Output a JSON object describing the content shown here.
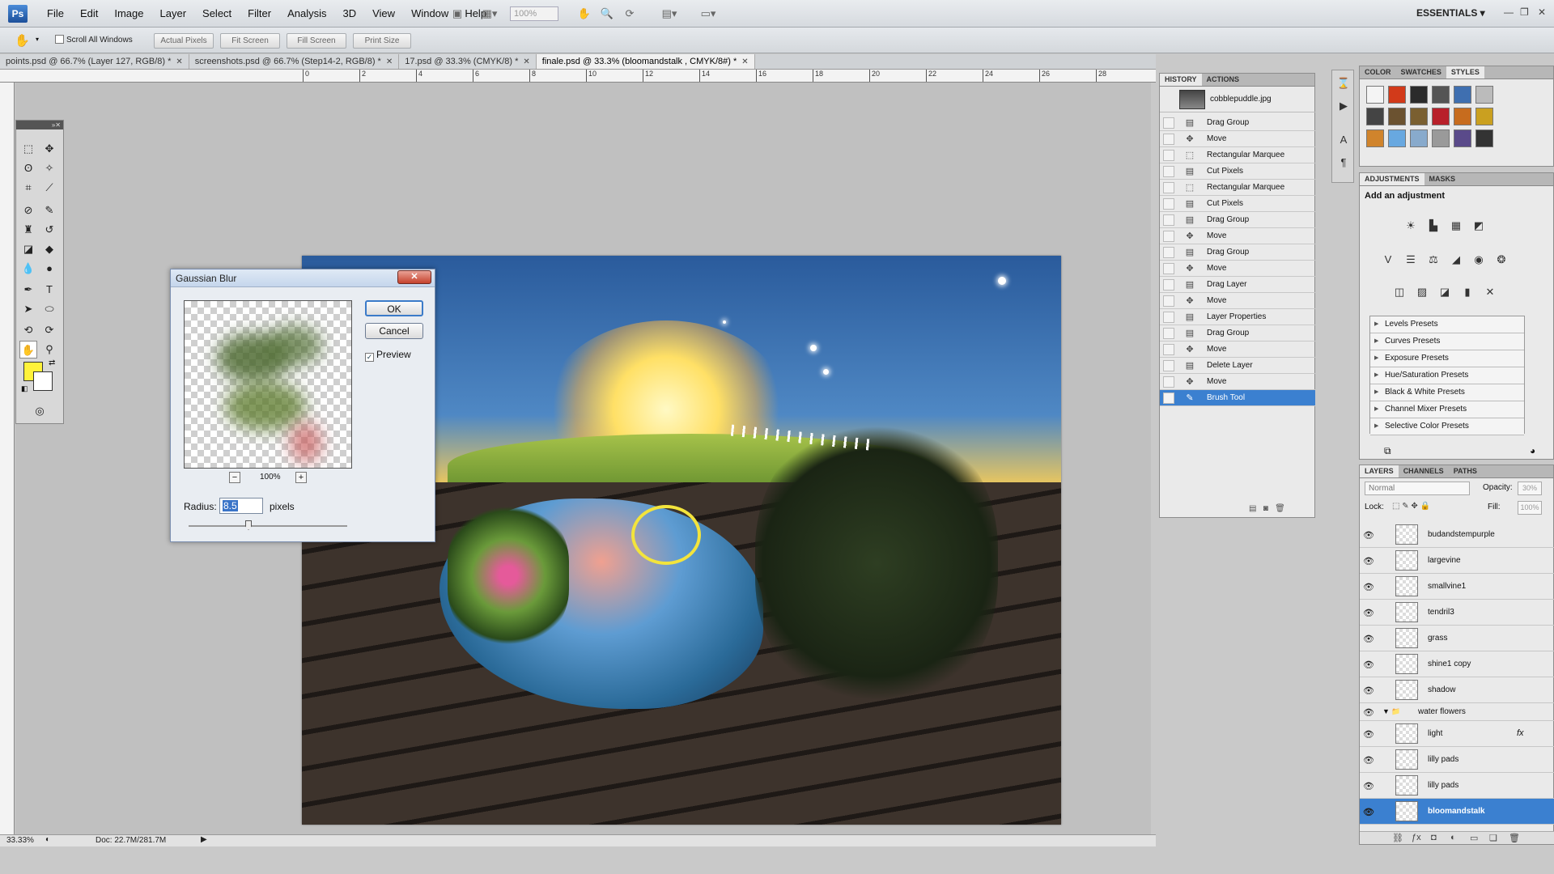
{
  "app": {
    "logo": "Ps",
    "workspace": "ESSENTIALS ▾",
    "zoom_combo": "100%"
  },
  "menu": [
    "File",
    "Edit",
    "Image",
    "Layer",
    "Select",
    "Filter",
    "Analysis",
    "3D",
    "View",
    "Window",
    "Help"
  ],
  "options_bar": {
    "scroll_all": "Scroll All Windows",
    "actual_pixels": "Actual Pixels",
    "fit_screen": "Fit Screen",
    "fill_screen": "Fill Screen",
    "print_size": "Print Size"
  },
  "tabs": [
    {
      "label": "points.psd @ 66.7% (Layer 127, RGB/8) *"
    },
    {
      "label": "screenshots.psd @ 66.7% (Step14-2, RGB/8) *"
    },
    {
      "label": "17.psd @ 33.3% (CMYK/8) *"
    },
    {
      "label": "finale.psd @ 33.3% (bloomandstalk , CMYK/8#) *"
    }
  ],
  "ruler_labels": [
    "0",
    "2",
    "4",
    "6",
    "8",
    "10",
    "12",
    "14",
    "16",
    "18",
    "20",
    "22",
    "24",
    "26",
    "28"
  ],
  "status": {
    "zoom": "33.33%",
    "doc": "Doc: 22.7M/281.7M"
  },
  "gaussian_blur": {
    "title": "Gaussian Blur",
    "ok": "OK",
    "cancel": "Cancel",
    "preview": "Preview",
    "zoom": "100%",
    "zoom_minus": "−",
    "zoom_plus": "+",
    "radius_label": "Radius:",
    "radius_value": "8.5",
    "unit": "pixels",
    "close": "✕"
  },
  "history": {
    "tabs": [
      "HISTORY",
      "ACTIONS"
    ],
    "snapshot": "cobblepuddle.jpg",
    "items": [
      "Drag Group",
      "Move",
      "Rectangular Marquee",
      "Cut Pixels",
      "Rectangular Marquee",
      "Cut Pixels",
      "Drag Group",
      "Move",
      "Drag Group",
      "Move",
      "Drag Layer",
      "Move",
      "Layer Properties",
      "Drag Group",
      "Move",
      "Delete Layer",
      "Move",
      "Brush Tool"
    ],
    "active_index": 17
  },
  "styles": {
    "tabs": [
      "COLOR",
      "SWATCHES",
      "STYLES"
    ]
  },
  "adjustments": {
    "tabs": [
      "ADJUSTMENTS",
      "MASKS"
    ],
    "title": "Add an adjustment",
    "presets": [
      "Levels Presets",
      "Curves Presets",
      "Exposure Presets",
      "Hue/Saturation Presets",
      "Black & White Presets",
      "Channel Mixer Presets",
      "Selective Color Presets"
    ]
  },
  "layers": {
    "tabs": [
      "LAYERS",
      "CHANNELS",
      "PATHS"
    ],
    "blend_mode": "Normal",
    "opacity_label": "Opacity:",
    "opacity": "30%",
    "lock_label": "Lock:",
    "fill_label": "Fill:",
    "fill": "100%",
    "items": [
      {
        "name": "budandstempurple"
      },
      {
        "name": "largevine"
      },
      {
        "name": "smallvine1"
      },
      {
        "name": "tendril3"
      },
      {
        "name": "grass"
      },
      {
        "name": "shine1 copy"
      },
      {
        "name": "shadow"
      },
      {
        "name": "water flowers",
        "group": true
      },
      {
        "name": "light",
        "fx": true
      },
      {
        "name": "lilly pads"
      },
      {
        "name": "lilly pads"
      },
      {
        "name": "bloomandstalk",
        "active": true
      }
    ],
    "fx_symbol": "fx"
  }
}
